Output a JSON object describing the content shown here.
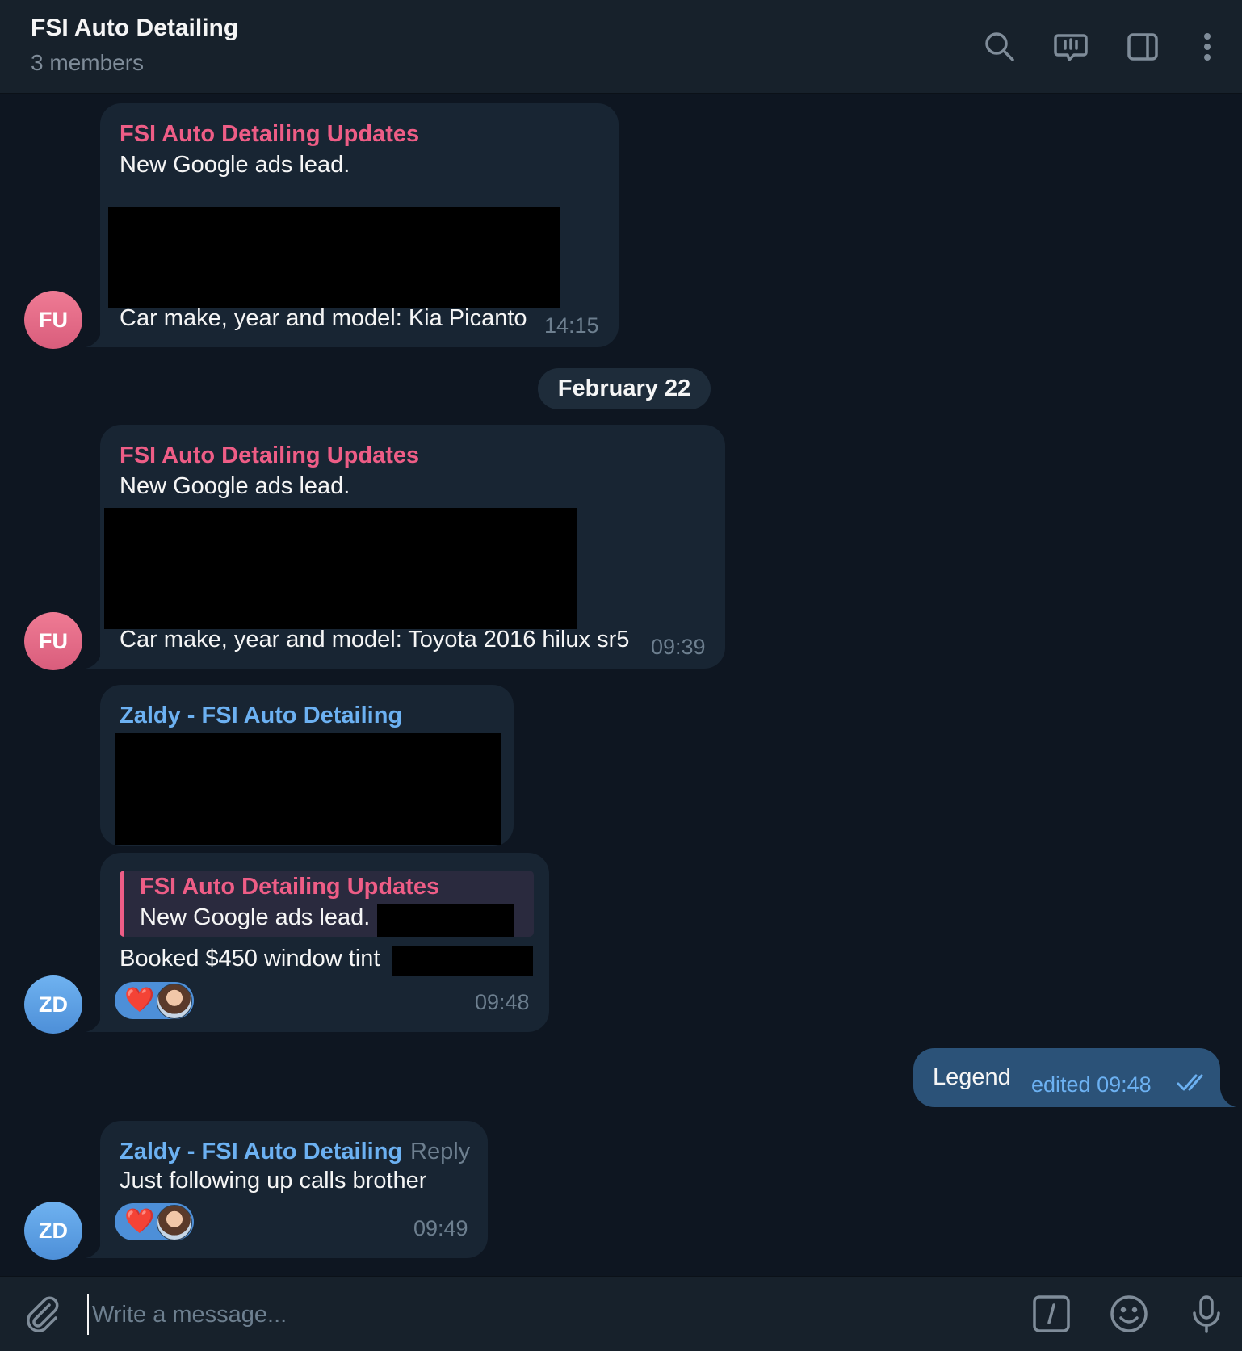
{
  "header": {
    "title": "FSI Auto Detailing",
    "subtitle": "3 members",
    "icons": [
      "search-icon",
      "video-chat-icon",
      "sidebar-toggle-icon",
      "more-vertical-icon"
    ]
  },
  "date_separator": "February 22",
  "messages": [
    {
      "avatar": "FU",
      "sender": "FSI Auto Detailing Updates",
      "line1": "New Google ads lead.",
      "line2": "Car make, year and model: Kia Picanto",
      "time": "14:15"
    },
    {
      "avatar": "FU",
      "sender": "FSI Auto Detailing Updates",
      "line1": "New Google ads lead.",
      "line2": "Car make, year and model: Toyota 2016 hilux sr5",
      "time": "09:39"
    },
    {
      "avatar": "ZD",
      "sender": "Zaldy - FSI Auto Detailing",
      "quote_sender": "FSI Auto Detailing Updates",
      "quote_text": "New Google ads lead.",
      "text": "Booked $450 window tint",
      "reaction": "❤️",
      "time": "09:48"
    },
    {
      "outgoing": true,
      "text": "Legend",
      "status": "edited 09:48"
    },
    {
      "avatar": "ZD",
      "sender": "Zaldy - FSI Auto Detailing",
      "reply_label": "Reply",
      "text": "Just following up calls brother",
      "reaction": "❤️",
      "time": "09:49"
    }
  ],
  "composer": {
    "placeholder": "Write a message...",
    "icons": [
      "attach-icon",
      "commands-icon",
      "emoji-icon",
      "microphone-icon"
    ]
  },
  "colors": {
    "background": "#0e1621",
    "header": "#17212b",
    "incoming_bubble": "#182533",
    "outgoing_bubble": "#2b5278",
    "pink_sender": "#ee5d86",
    "blue_sender": "#6cb1f2"
  }
}
